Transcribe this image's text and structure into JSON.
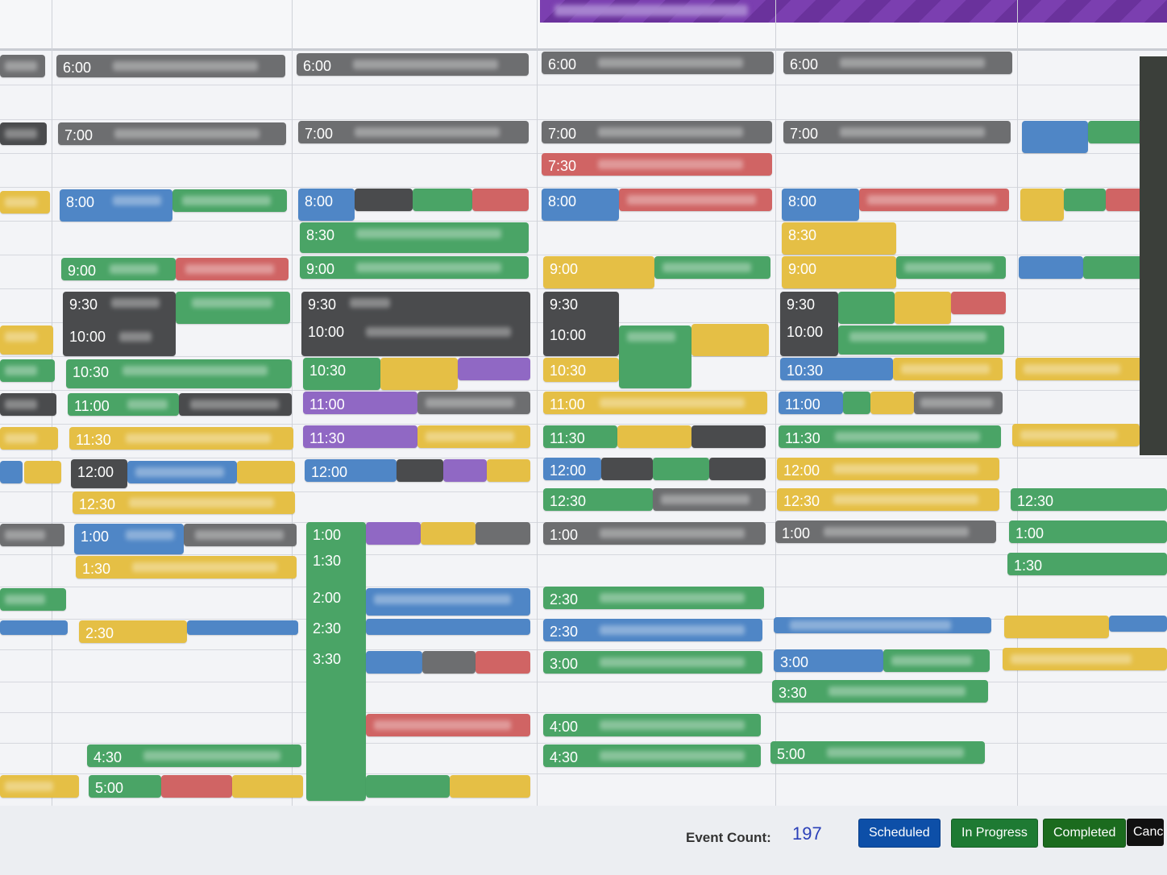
{
  "colors": {
    "gray": "#6d6e70",
    "dark": "#4a4b4d",
    "blue": "#4f86c6",
    "green": "#4aa466",
    "red": "#d06464",
    "yellow": "#e5bf45",
    "purple": "#9068c4",
    "scheduled": "#0d4fa8",
    "in_progress": "#1e7a33",
    "completed": "#1b6b1e",
    "cancelled": "#111111"
  },
  "footer": {
    "event_count_label": "Event Count:",
    "event_count_value": "197",
    "legend": [
      {
        "label": "Scheduled",
        "color": "scheduled"
      },
      {
        "label": "In Progress",
        "color": "in_progress"
      },
      {
        "label": "Completed",
        "color": "completed"
      },
      {
        "label": "Canc",
        "color": "cancelled"
      }
    ]
  },
  "events": [
    {
      "time": "6:00",
      "color": "gray"
    },
    {
      "time": "7:00",
      "color": "gray"
    },
    {
      "time": "8:00",
      "color": "blue"
    },
    {
      "time": "9:00",
      "color": "green"
    },
    {
      "time": "9:30",
      "color": "dark"
    },
    {
      "time": "10:00",
      "color": "dark"
    },
    {
      "time": "10:30",
      "color": "green"
    },
    {
      "time": "11:00",
      "color": "green"
    },
    {
      "time": "11:30",
      "color": "yellow"
    },
    {
      "time": "12:00",
      "color": "dark"
    },
    {
      "time": "12:30",
      "color": "yellow"
    },
    {
      "time": "1:00",
      "color": "blue"
    },
    {
      "time": "1:30",
      "color": "yellow"
    },
    {
      "time": "2:30",
      "color": "yellow"
    },
    {
      "time": "4:30",
      "color": "green"
    },
    {
      "time": "5:00",
      "color": "green"
    },
    {
      "time": "6:00",
      "color": "gray"
    },
    {
      "time": "7:00",
      "color": "gray"
    },
    {
      "time": "8:00",
      "color": "blue"
    },
    {
      "time": "8:30",
      "color": "green"
    },
    {
      "time": "9:00",
      "color": "green"
    },
    {
      "time": "9:30",
      "color": "dark"
    },
    {
      "time": "10:00",
      "color": "dark"
    },
    {
      "time": "10:30",
      "color": "green"
    },
    {
      "time": "11:00",
      "color": "purple"
    },
    {
      "time": "11:30",
      "color": "purple"
    },
    {
      "time": "12:00",
      "color": "blue"
    },
    {
      "time": "1:00",
      "color": "green"
    },
    {
      "time": "1:30",
      "color": "green"
    },
    {
      "time": "2:00",
      "color": "green"
    },
    {
      "time": "2:30",
      "color": "green"
    },
    {
      "time": "3:30",
      "color": "green"
    },
    {
      "time": "6:00",
      "color": "gray"
    },
    {
      "time": "7:00",
      "color": "gray"
    },
    {
      "time": "7:30",
      "color": "red"
    },
    {
      "time": "8:00",
      "color": "blue"
    },
    {
      "time": "9:00",
      "color": "yellow"
    },
    {
      "time": "9:30",
      "color": "dark"
    },
    {
      "time": "10:00",
      "color": "dark"
    },
    {
      "time": "10:30",
      "color": "yellow"
    },
    {
      "time": "11:00",
      "color": "yellow"
    },
    {
      "time": "11:30",
      "color": "green"
    },
    {
      "time": "12:00",
      "color": "blue"
    },
    {
      "time": "12:30",
      "color": "green"
    },
    {
      "time": "1:00",
      "color": "gray"
    },
    {
      "time": "2:30",
      "color": "green"
    },
    {
      "time": "2:30",
      "color": "blue"
    },
    {
      "time": "3:00",
      "color": "green"
    },
    {
      "time": "4:00",
      "color": "green"
    },
    {
      "time": "4:30",
      "color": "green"
    },
    {
      "time": "6:00",
      "color": "gray"
    },
    {
      "time": "7:00",
      "color": "gray"
    },
    {
      "time": "8:00",
      "color": "blue"
    },
    {
      "time": "8:30",
      "color": "yellow"
    },
    {
      "time": "9:00",
      "color": "yellow"
    },
    {
      "time": "9:30",
      "color": "dark"
    },
    {
      "time": "10:00",
      "color": "dark"
    },
    {
      "time": "10:30",
      "color": "blue"
    },
    {
      "time": "11:00",
      "color": "blue"
    },
    {
      "time": "11:30",
      "color": "green"
    },
    {
      "time": "12:00",
      "color": "yellow"
    },
    {
      "time": "12:30",
      "color": "yellow"
    },
    {
      "time": "1:00",
      "color": "gray"
    },
    {
      "time": "3:00",
      "color": "blue"
    },
    {
      "time": "3:30",
      "color": "green"
    },
    {
      "time": "5:00",
      "color": "green"
    },
    {
      "time": "12:30",
      "color": "green"
    },
    {
      "time": "1:00",
      "color": "green"
    },
    {
      "time": "1:30",
      "color": "green"
    }
  ]
}
